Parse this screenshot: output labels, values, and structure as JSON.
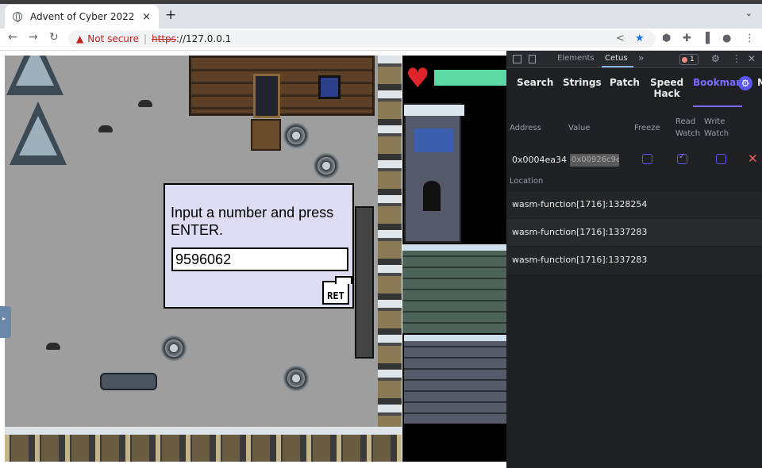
{
  "browser": {
    "tab_title": "Advent of Cyber 2022",
    "tab_close": "×",
    "new_tab": "+",
    "tab_menu": "⌄",
    "nav": {
      "back": "←",
      "forward": "→",
      "reload": "↻"
    },
    "omnibox": {
      "warning_icon": "▲",
      "security_label": "Not secure",
      "separator": "|",
      "scheme": "https",
      "host": "://127.0.0.1"
    },
    "toolbar_icons": {
      "share": "<",
      "star": "★",
      "extension1": "⬢",
      "extensions": "✚",
      "sidepanel": "▐",
      "profile": "●",
      "menu": "⋮"
    }
  },
  "game": {
    "dialog": {
      "prompt": "Input a number and press ENTER.",
      "input_value": "9596062",
      "ret_label": "RET"
    },
    "heart": "♥"
  },
  "devtools": {
    "tabs": [
      "Elements",
      "Cetus"
    ],
    "more": "»",
    "error_count": "1",
    "icons": {
      "settings": "⚙",
      "more": "⋮",
      "close": "✕"
    },
    "cetus_nav": {
      "search": "Search",
      "strings": "Strings",
      "patch": "Patch",
      "speed_hack_1": "Speed",
      "speed_hack_2": "Hack",
      "bookmarks": "Bookmark",
      "gear": "⚙",
      "cut": "M"
    },
    "bookmarks": {
      "headers": {
        "address": "Address",
        "value": "Value",
        "freeze": "Freeze",
        "read_watch_1": "Read",
        "read_watch_2": "Watch",
        "write_watch_1": "Write",
        "write_watch_2": "Watch"
      },
      "row": {
        "address": "0x0004ea34",
        "value": "0x00926c9e",
        "freeze": false,
        "read_watch": true,
        "write_watch": false,
        "delete": "✕"
      },
      "location_label": "Location",
      "locations": [
        "wasm-function[1716]:1328254",
        "wasm-function[1716]:1337283",
        "wasm-function[1716]:1337283"
      ]
    }
  }
}
